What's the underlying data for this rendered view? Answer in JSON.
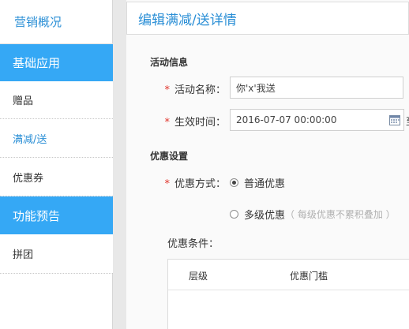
{
  "sidebar": {
    "top_label": "营销概况",
    "sections": [
      {
        "label": "基础应用"
      },
      {
        "label": "功能预告"
      }
    ],
    "items": [
      {
        "label": "赠品"
      },
      {
        "label": "满减/送"
      },
      {
        "label": "优惠券"
      },
      {
        "label": "拼团"
      }
    ]
  },
  "page": {
    "title": "编辑满减/送详情"
  },
  "activity_info": {
    "section_title": "活动信息",
    "name_label": "活动名称：",
    "name_value": "你'x'我送",
    "time_label": "生效时间：",
    "time_value": "2016-07-07 00:00:00",
    "time_trailing": "至"
  },
  "discount_settings": {
    "section_title": "优惠设置",
    "mode_label": "优惠方式：",
    "options": [
      {
        "label": "普通优惠",
        "selected": true
      },
      {
        "label": "多级优惠",
        "hint": "（ 每级优惠不累积叠加 ）",
        "selected": false
      }
    ],
    "condition_label": "优惠条件：",
    "table_headers": [
      "层级",
      "优惠门槛"
    ]
  },
  "required_mark": "*",
  "colors": {
    "accent": "#35a8f5",
    "link": "#2b8fd6",
    "required": "#e0342b"
  }
}
